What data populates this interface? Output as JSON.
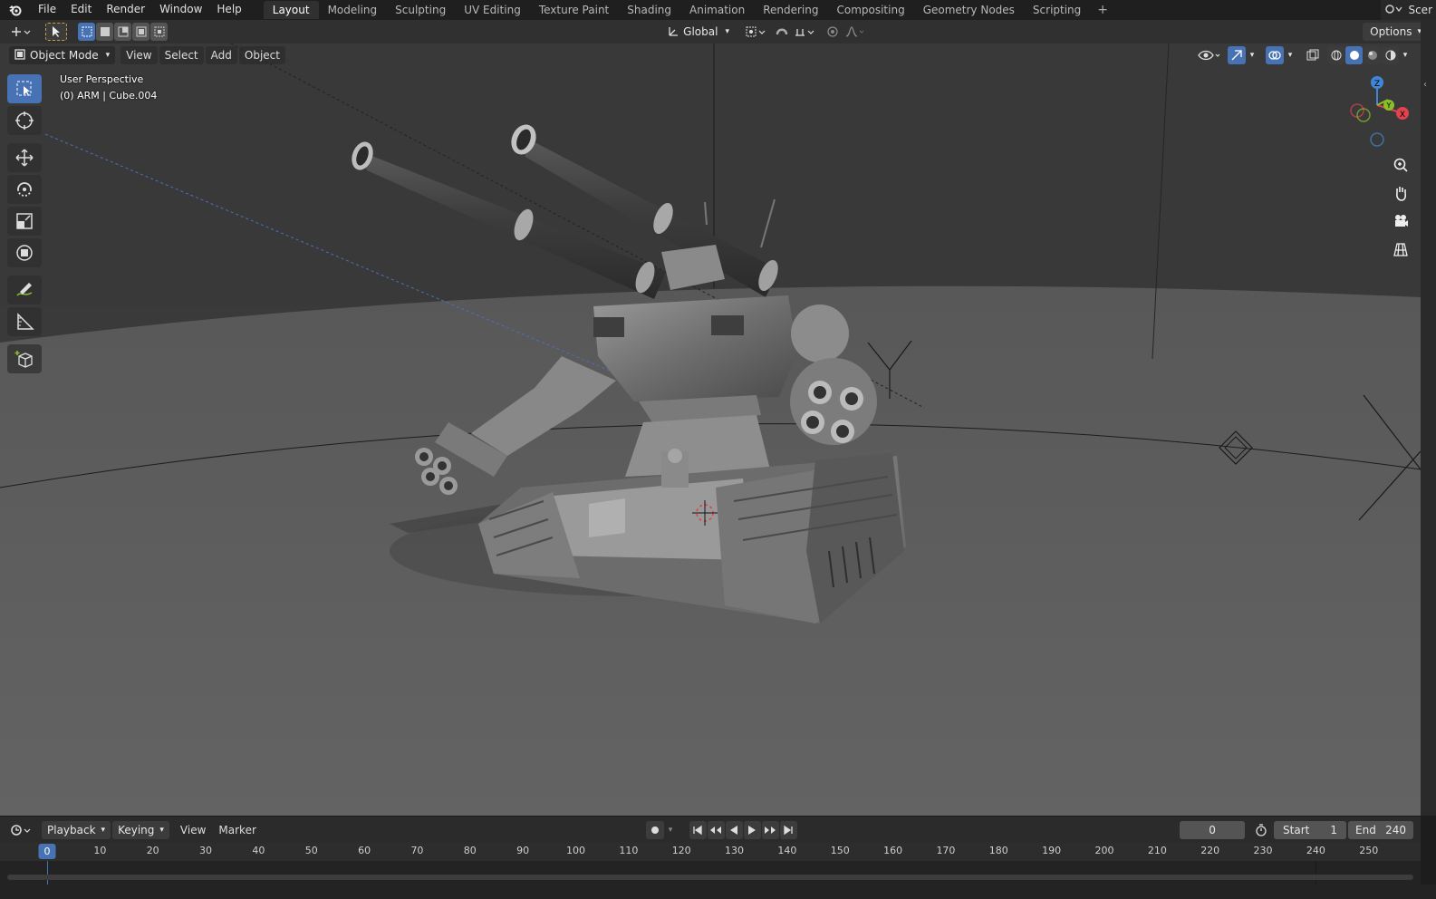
{
  "topbar": {
    "logo_icon": "blender-logo-icon",
    "menus": [
      "File",
      "Edit",
      "Render",
      "Window",
      "Help"
    ],
    "workspace_tabs": [
      "Layout",
      "Modeling",
      "Sculpting",
      "UV Editing",
      "Texture Paint",
      "Shading",
      "Animation",
      "Rendering",
      "Compositing",
      "Geometry Nodes",
      "Scripting"
    ],
    "active_tab": "Layout",
    "add_tab_icon": "plus-icon",
    "scene_label": "Scer"
  },
  "tool_header": {
    "transform_orientation": "Global",
    "options_label": "Options"
  },
  "viewport": {
    "mode": "Object Mode",
    "menus": [
      "View",
      "Select",
      "Add",
      "Object"
    ],
    "perspective_label": "User Perspective",
    "object_label": "(0) ARM | Cube.004",
    "gizmo_axes": {
      "z": "Z",
      "y": "Y",
      "x": "X"
    },
    "colors": {
      "background": "#3a3a3a",
      "floor": "#5e5e5e",
      "x_axis": "#e0434d",
      "y_axis": "#8bbf2a",
      "z_axis": "#3f87d6",
      "active_tool": "#4772b3"
    }
  },
  "toolbar": {
    "tools": [
      "select-box-icon",
      "cursor-icon",
      "move-icon",
      "rotate-icon",
      "scale-icon",
      "transform-icon",
      "annotate-icon",
      "measure-icon",
      "add-cube-icon"
    ]
  },
  "nav_tools": [
    "zoom-icon",
    "hand-pan-icon",
    "camera-icon",
    "grid-ortho-icon"
  ],
  "timeline": {
    "menus": [
      "Playback",
      "Keying",
      "View",
      "Marker"
    ],
    "current_frame": "0",
    "start_label": "Start",
    "start_value": "1",
    "end_label": "End",
    "end_value": "240",
    "ruler_marks": [
      "10",
      "20",
      "30",
      "40",
      "50",
      "60",
      "70",
      "80",
      "90",
      "100",
      "110",
      "120",
      "130",
      "140",
      "150",
      "160",
      "170",
      "180",
      "190",
      "200",
      "210",
      "220",
      "230",
      "240",
      "250"
    ],
    "marker_value": "0"
  }
}
